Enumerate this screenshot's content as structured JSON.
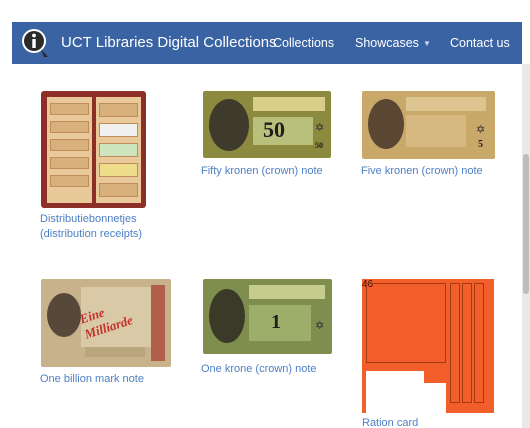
{
  "navbar": {
    "brand": "UCT Libraries Digital Collections",
    "links": [
      {
        "label": "Collections"
      },
      {
        "label": "Showcases",
        "has_dropdown": true
      },
      {
        "label": "Contact us"
      }
    ],
    "logo_icon": "info-pin-icon",
    "background_color": "#3a63a3"
  },
  "items": [
    {
      "caption": "Distributiebonnetjes",
      "caption_line2": "(distribution receipts)"
    },
    {
      "caption": "Fifty kronen (crown) note",
      "note_value": "50"
    },
    {
      "caption": "Five kronen (crown) note",
      "note_value": "5"
    },
    {
      "caption": "One billion mark note"
    },
    {
      "caption": "One krone (crown) note",
      "note_value": "1"
    },
    {
      "caption": "Ration card",
      "card_number": "46"
    }
  ],
  "caption_color": "#4d7fc4"
}
